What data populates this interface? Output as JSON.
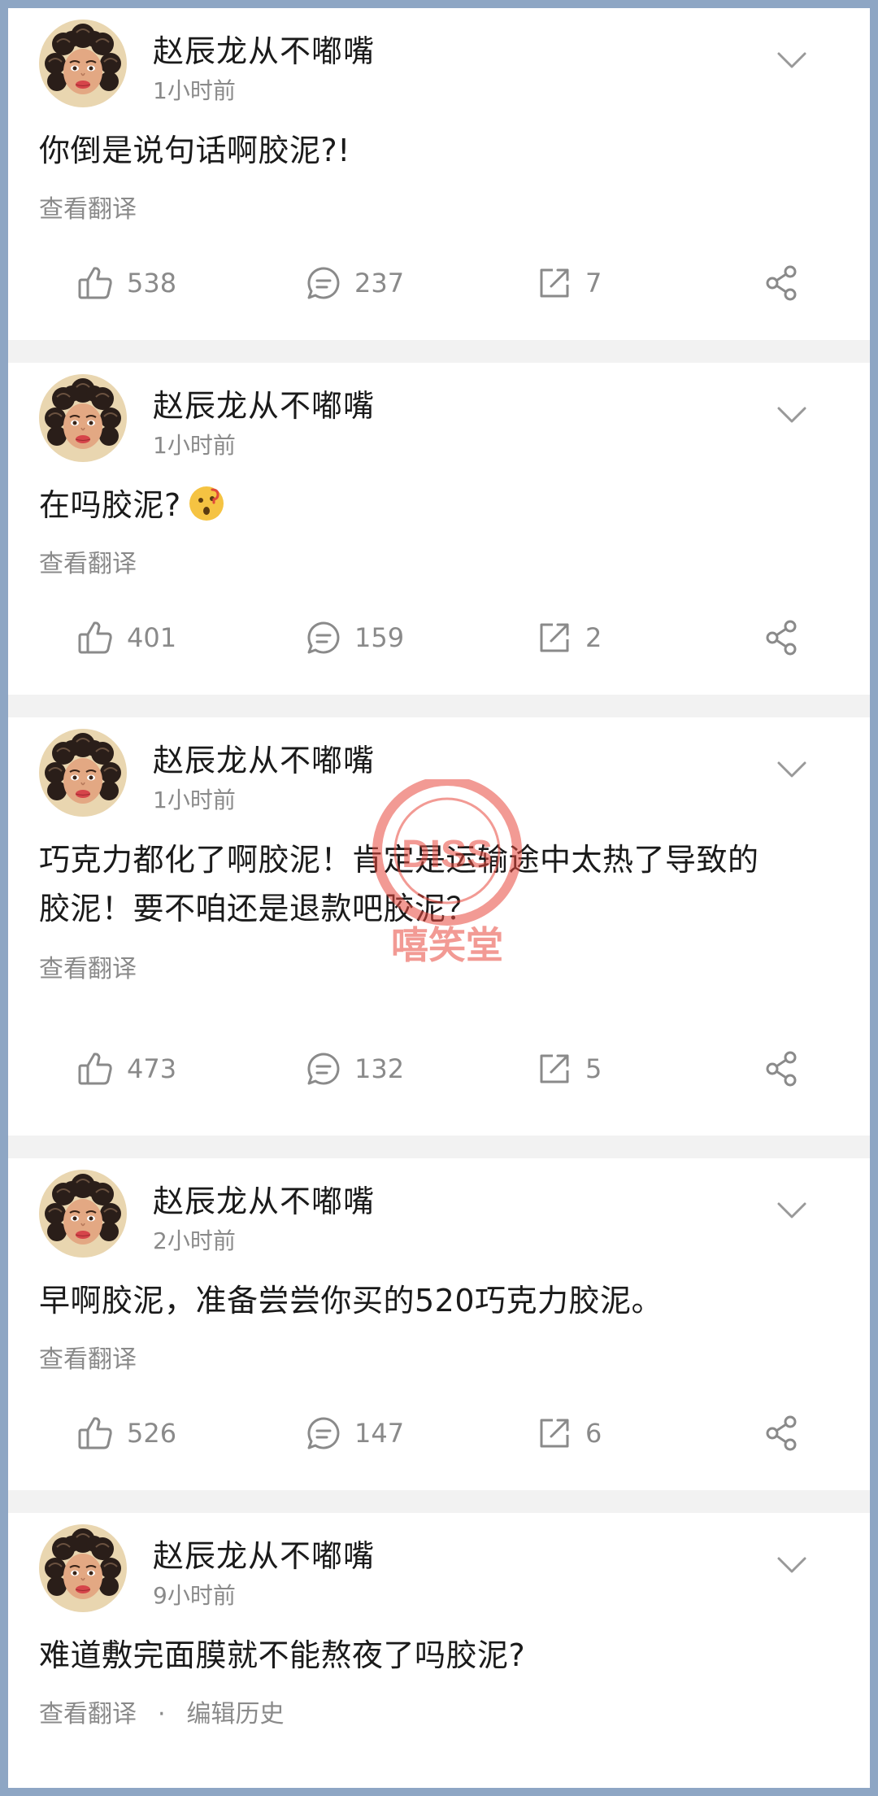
{
  "posts": [
    {
      "name": "赵辰龙从不嘟嘴",
      "time": "1小时前",
      "text": "你倒是说句话啊胶泥?!",
      "translate": "查看翻译",
      "likes": "538",
      "comments": "237",
      "shares": "7"
    },
    {
      "name": "赵辰龙从不嘟嘴",
      "time": "1小时前",
      "text": "在吗胶泥?",
      "translate": "查看翻译",
      "likes": "401",
      "comments": "159",
      "shares": "2",
      "emoji": "thinking-face-emoji"
    },
    {
      "name": "赵辰龙从不嘟嘴",
      "time": "1小时前",
      "text_lines": [
        "巧克力都化了啊胶泥！肯定是运输途中太热了导致的",
        "胶泥！要不咱还是退款吧胶泥？"
      ],
      "translate": "查看翻译",
      "likes": "473",
      "comments": "132",
      "shares": "5"
    },
    {
      "name": "赵辰龙从不嘟嘴",
      "time": "2小时前",
      "text": "早啊胶泥，准备尝尝你买的520巧克力胶泥。",
      "translate": "查看翻译",
      "likes": "526",
      "comments": "147",
      "shares": "6"
    },
    {
      "name": "赵辰龙从不嘟嘴",
      "time": "9小时前",
      "text": "难道敷完面膜就不能熬夜了吗胶泥?",
      "translate": "查看翻译",
      "edit_history": "编辑历史",
      "separator": "·"
    }
  ],
  "icons": {
    "like": "thumbs-up-icon",
    "comment": "comment-bubble-icon",
    "repost": "repost-icon",
    "share": "share-icon",
    "more": "chevron-down-icon"
  },
  "watermark": {
    "top": "DISS",
    "bottom": "嘻笑堂",
    "color": "#e8493d"
  }
}
